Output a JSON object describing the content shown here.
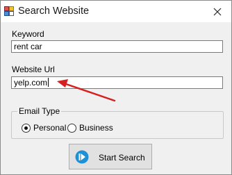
{
  "window": {
    "title": "Search Website"
  },
  "form": {
    "keyword_label": "Keyword",
    "keyword_value": "rent car",
    "url_label": "Website Url",
    "url_value": "yelp.com"
  },
  "email_type": {
    "legend": "Email Type",
    "options": [
      {
        "label": "Personal",
        "selected": true
      },
      {
        "label": "Business",
        "selected": false
      }
    ]
  },
  "actions": {
    "search_label": "Start Search"
  },
  "colors": {
    "annotation_arrow": "#d61f1f",
    "button_icon": "#1e90d6"
  }
}
